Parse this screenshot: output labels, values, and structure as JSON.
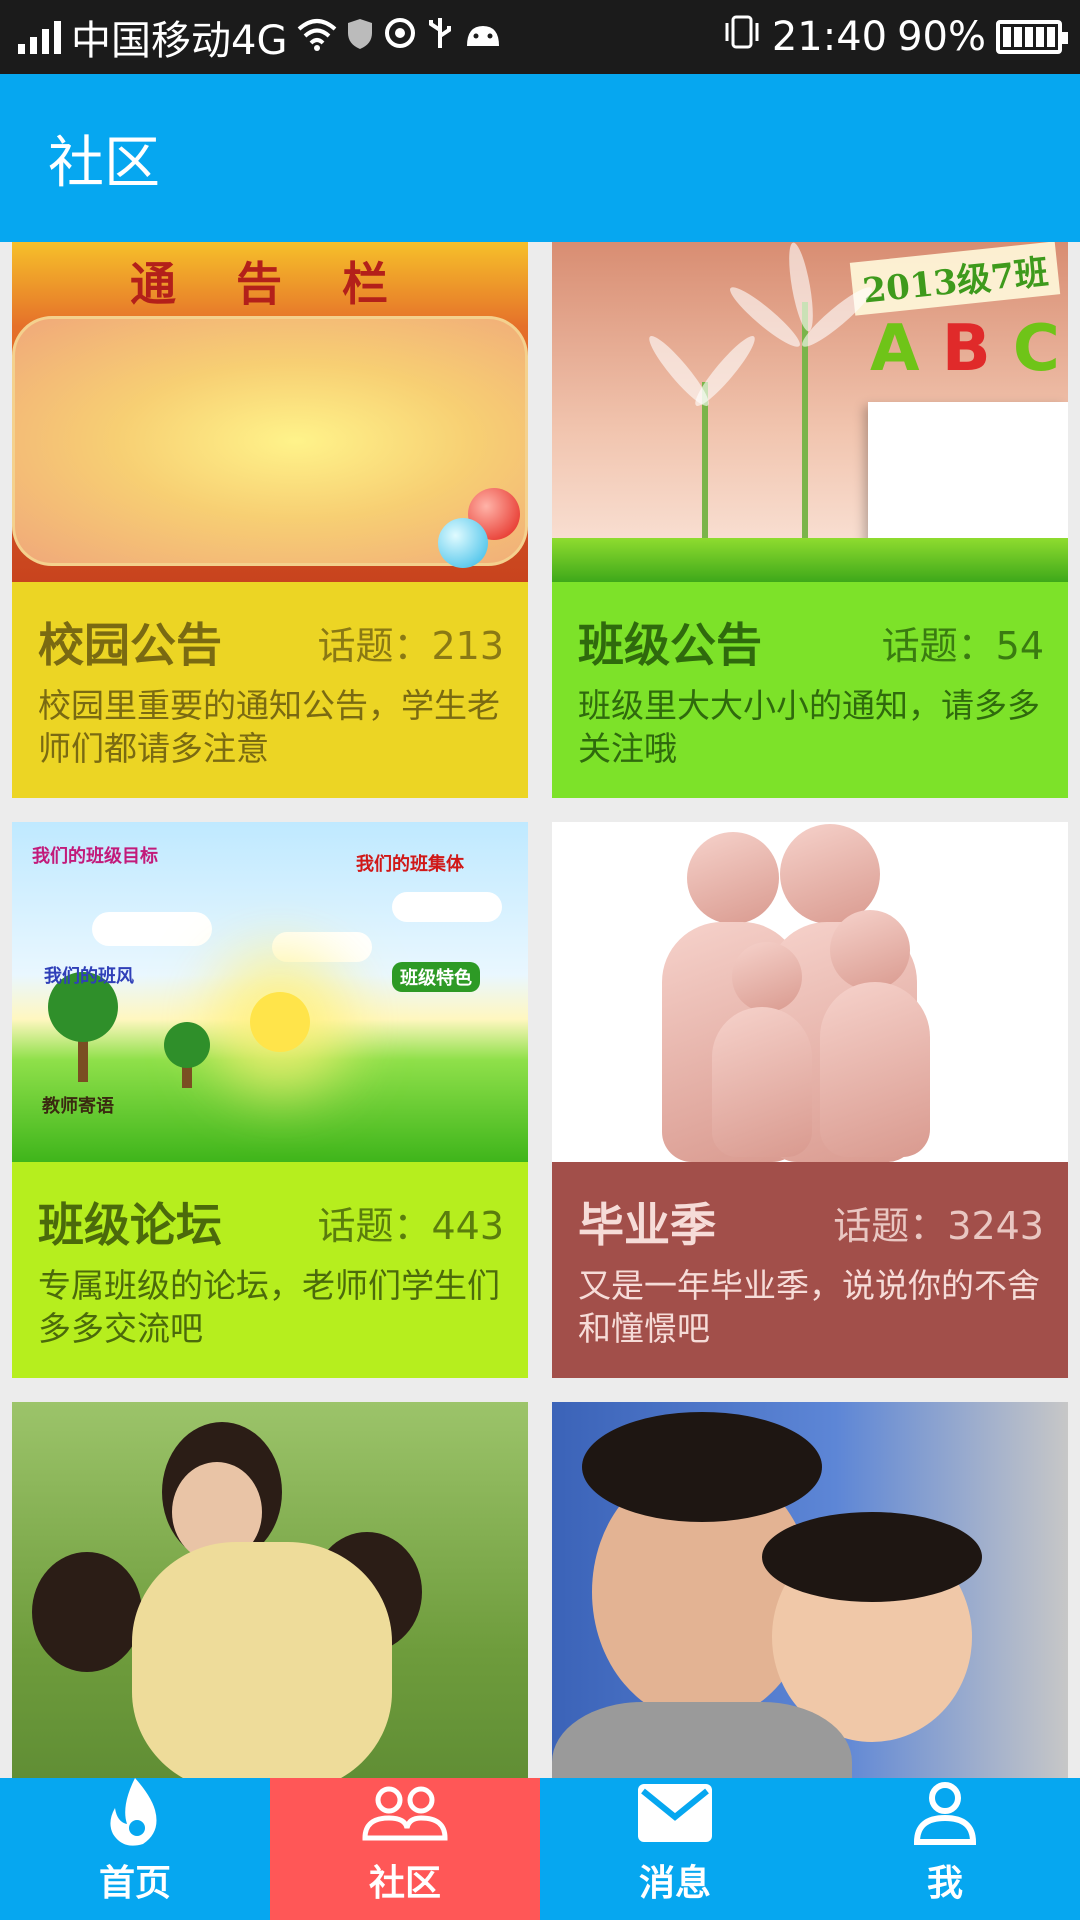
{
  "status_bar": {
    "carrier": "中国移动4G",
    "time": "21:40",
    "battery": "90%"
  },
  "app_bar": {
    "title": "社区"
  },
  "cards": [
    {
      "title": "校园公告",
      "topic_label": "话题：",
      "topic_count": "213",
      "description": "校园里重要的通知公告，学生老师们都请多注意",
      "color": "#ecd524",
      "text_color": "#7a6a12",
      "image_text": "通 告 栏"
    },
    {
      "title": "班级公告",
      "topic_label": "话题：",
      "topic_count": "54",
      "description": "班级里大大小小的通知，请多多关注哦",
      "color": "#7de229",
      "text_color": "#2f6a0d",
      "image_text": "2013级7班"
    },
    {
      "title": "班级论坛",
      "topic_label": "话题：",
      "topic_count": "443",
      "description": "专属班级的论坛，老师们学生们多多交流吧",
      "color": "#b6ee1e",
      "text_color": "#4b6a0b",
      "image_labels": [
        "我们的班级目标",
        "我们的班集体",
        "我们的班风",
        "班级特色",
        "教师寄语"
      ]
    },
    {
      "title": "毕业季",
      "topic_label": "话题：",
      "topic_count": "3243",
      "description": "又是一年毕业季，说说你的不舍和憧憬吧",
      "color": "#a24f4a",
      "text_color": "#f6dcd8"
    },
    {
      "title": "",
      "topic_label": "",
      "topic_count": "",
      "description": ""
    },
    {
      "title": "",
      "topic_label": "",
      "topic_count": "",
      "description": ""
    }
  ],
  "tabs": [
    {
      "label": "首页",
      "icon": "flame-icon"
    },
    {
      "label": "社区",
      "icon": "people-icon",
      "active": true
    },
    {
      "label": "消息",
      "icon": "mail-icon"
    },
    {
      "label": "我",
      "icon": "person-icon"
    }
  ],
  "colors": {
    "primary": "#06a7f0",
    "active_tab": "#ff5757",
    "background": "#ececec"
  }
}
